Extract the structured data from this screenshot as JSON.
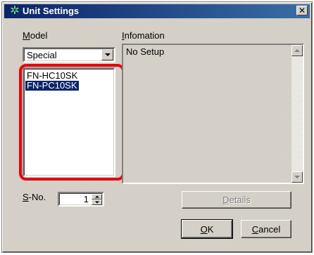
{
  "window": {
    "title": "Unit Settings",
    "close_glyph": "✕",
    "icon": "gear-icon",
    "icon_glyph": "✲"
  },
  "model": {
    "label_accel": "M",
    "label_rest": "odel",
    "selected": "Special",
    "list": [
      {
        "text": "FN-HC10SK",
        "selected": false
      },
      {
        "text": "FN-PC10SK",
        "selected": true
      }
    ]
  },
  "information": {
    "label_accel": "I",
    "label_rest": "nfomation",
    "text": "No Setup"
  },
  "station": {
    "label_accel": "S",
    "label_rest": "-No.",
    "value": "1"
  },
  "buttons": {
    "details_accel": "D",
    "details_rest": "etails",
    "ok_accel": "O",
    "ok_rest": "K",
    "cancel_accel": "C",
    "cancel_rest": "ancel"
  },
  "colors": {
    "highlight": "#e8000c",
    "selection": "#0a246a",
    "titlebar": "#0a246a"
  }
}
